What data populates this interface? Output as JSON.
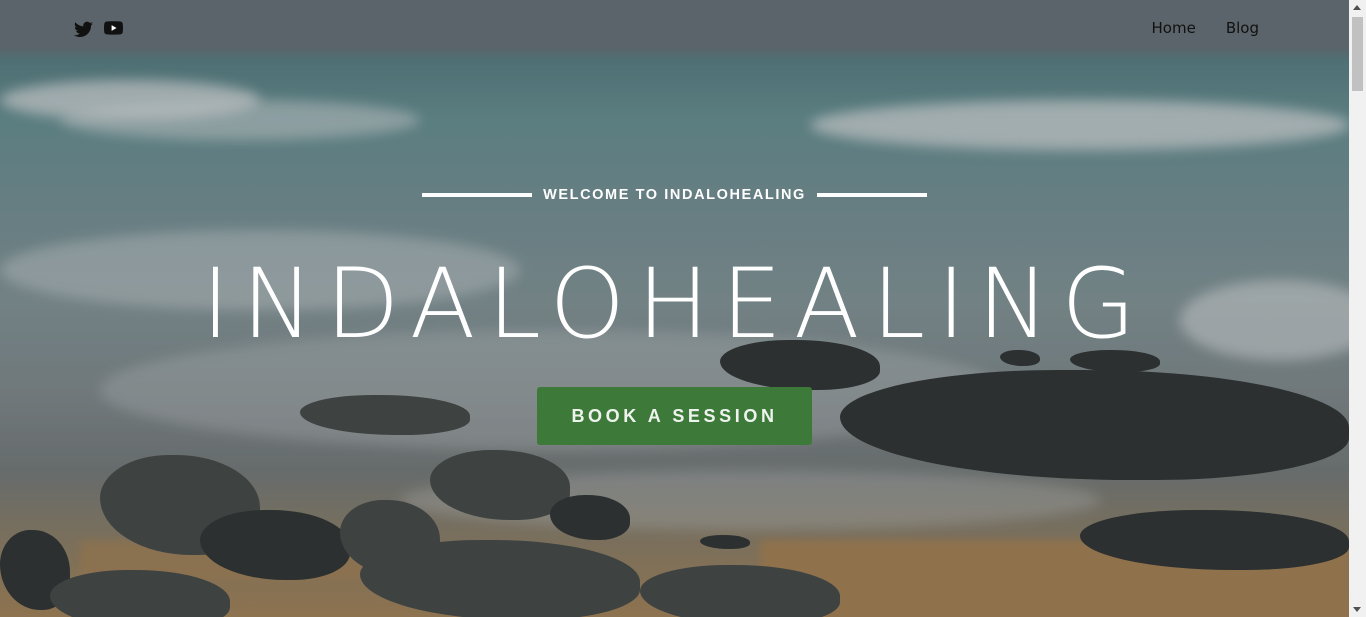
{
  "social": {
    "twitter_icon": "twitter-icon",
    "youtube_icon": "youtube-icon"
  },
  "nav": {
    "items": [
      {
        "label": "Home"
      },
      {
        "label": "Blog"
      }
    ]
  },
  "hero": {
    "welcome": "WELCOME TO INDALOHEALING",
    "title": "INDALOHEALING",
    "cta": "BOOK A SESSION"
  },
  "colors": {
    "cta_background": "#3d7a3a",
    "text": "#ffffff",
    "nav_text": "#111111"
  }
}
